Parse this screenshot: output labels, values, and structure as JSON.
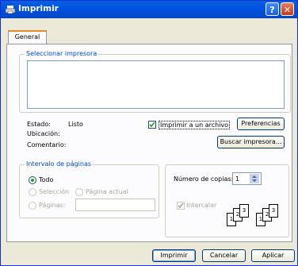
{
  "window": {
    "title": "Imprimir",
    "help_glyph": "?",
    "close_glyph": "✕"
  },
  "tabs": [
    {
      "label": "General"
    }
  ],
  "printer_group": {
    "legend": "Seleccionar impresora"
  },
  "status": {
    "estado_label": "Estado:",
    "estado_value": "Listo",
    "ubicacion_label": "Ubicación:",
    "comentario_label": "Comentario:"
  },
  "print_to_file": {
    "label": "Imprimir a un archivo",
    "checked": true
  },
  "buttons": {
    "preferencias": "Preferencias",
    "buscar": "Buscar impresora...",
    "imprimir": "Imprimir",
    "cancelar": "Cancelar",
    "aplicar": "Aplicar"
  },
  "range_group": {
    "legend": "Intervalo de páginas",
    "todo": "Todo",
    "seleccion": "Selección",
    "pagina_actual": "Página actual",
    "paginas": "Páginas:",
    "selected": "todo"
  },
  "copies": {
    "label": "Número de copias:",
    "value": "1",
    "intercalar": "Intercalar",
    "intercalar_checked": true
  },
  "collate_icons": [
    [
      "1",
      "2",
      "3"
    ],
    [
      "1",
      "2",
      "3"
    ]
  ],
  "colors": {
    "title_bar": "#0054e3",
    "group_legend": "#0046d5",
    "window_face": "#ece9d8"
  }
}
